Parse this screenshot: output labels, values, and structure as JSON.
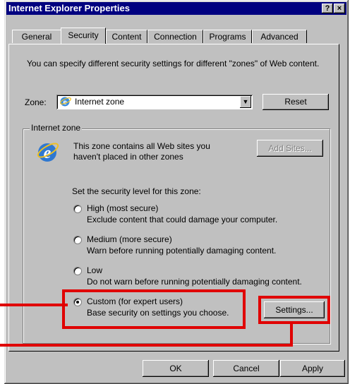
{
  "window": {
    "title": "Internet Explorer Properties",
    "help_glyph": "?",
    "close_glyph": "×"
  },
  "tabs": [
    {
      "label": "General"
    },
    {
      "label": "Security",
      "active": true
    },
    {
      "label": "Content"
    },
    {
      "label": "Connection"
    },
    {
      "label": "Programs"
    },
    {
      "label": "Advanced"
    }
  ],
  "security": {
    "intro": "You can specify different security settings for different \"zones\" of Web content.",
    "zone_label": "Zone:",
    "zone_value": "Internet zone",
    "reset_label": "Reset",
    "group_title": "Internet zone",
    "zone_description": "This zone contains all Web sites you haven't placed in other zones",
    "add_sites_label": "Add Sites...",
    "level_prompt": "Set the security level for this zone:",
    "levels": [
      {
        "title": "High (most secure)",
        "desc": "Exclude content that could damage your computer.",
        "checked": false
      },
      {
        "title": "Medium (more secure)",
        "desc": "Warn before running potentially damaging content.",
        "checked": false
      },
      {
        "title": "Low",
        "desc": "Do not warn before running potentially damaging content.",
        "checked": false
      },
      {
        "title": "Custom (for expert users)",
        "desc": "Base security on settings you choose.",
        "checked": true
      }
    ],
    "settings_label": "Settings..."
  },
  "footer": {
    "ok_label": "OK",
    "cancel_label": "Cancel",
    "apply_label": "Apply"
  },
  "colors": {
    "highlight": "#e00000",
    "titlebar": "#000080",
    "face": "#c0c0c0"
  },
  "icons": {
    "zone_icon": "ie-globe-icon"
  }
}
